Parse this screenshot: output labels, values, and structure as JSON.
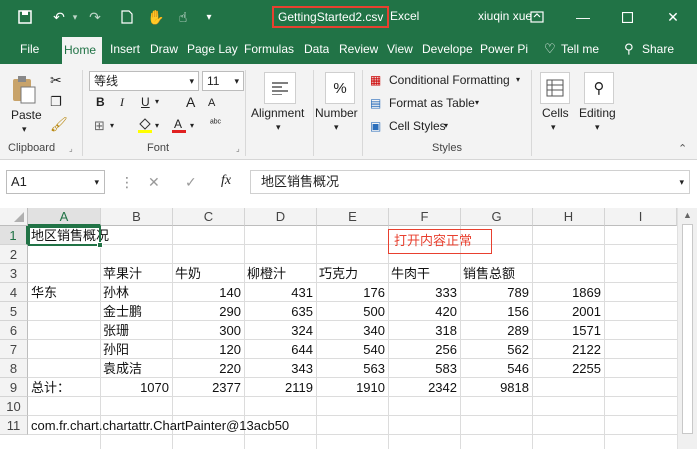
{
  "titlebar": {
    "file_name": "GettingStarted2.csv",
    "app_name": "Excel",
    "user": "xiuqin xue"
  },
  "tabs": [
    "File",
    "Home",
    "Insert",
    "Draw",
    "Page Layo",
    "Formulas",
    "Data",
    "Review",
    "View",
    "Develope",
    "Power Pi",
    "Tell me",
    "Share"
  ],
  "ribbon": {
    "clipboard": {
      "paste": "Paste",
      "label": "Clipboard"
    },
    "font": {
      "name": "等线",
      "size": "11",
      "bold": "B",
      "italic": "I",
      "underline": "U",
      "grow": "A",
      "shrink": "A",
      "label": "Font"
    },
    "alignment": {
      "label": "Alignment"
    },
    "number": {
      "label": "Number",
      "icon_text": "%"
    },
    "styles": {
      "conditional": "Conditional Formatting",
      "table": "Format as Table",
      "cell": "Cell Styles",
      "label": "Styles"
    },
    "cells": {
      "label": "Cells"
    },
    "editing": {
      "label": "Editing"
    }
  },
  "formula_bar": {
    "name_box": "A1",
    "fx": "fx",
    "content": "地区销售概况"
  },
  "columns": [
    "A",
    "B",
    "C",
    "D",
    "E",
    "F",
    "G",
    "H",
    "I"
  ],
  "rows": [
    "1",
    "2",
    "3",
    "4",
    "5",
    "6",
    "7",
    "8",
    "9",
    "10",
    "11"
  ],
  "cells": {
    "A1": "地区销售概况",
    "B3": "苹果汁",
    "C3": "牛奶",
    "D3": "柳橙汁",
    "E3": "巧克力",
    "F3": "牛肉干",
    "G3": "销售总额",
    "A4": "华东",
    "B4": "孙林",
    "C4": "140",
    "D4": "431",
    "E4": "176",
    "F4": "333",
    "G4": "789",
    "H4": "1869",
    "B5": "金士鹏",
    "C5": "290",
    "D5": "635",
    "E5": "500",
    "F5": "420",
    "G5": "156",
    "H5": "2001",
    "B6": "张珊",
    "C6": "300",
    "D6": "324",
    "E6": "340",
    "F6": "318",
    "G6": "289",
    "H6": "1571",
    "B7": "孙阳",
    "C7": "120",
    "D7": "644",
    "E7": "540",
    "F7": "256",
    "G7": "562",
    "H7": "2122",
    "B8": "袁成洁",
    "C8": "220",
    "D8": "343",
    "E8": "563",
    "F8": "583",
    "G8": "546",
    "H8": "2255",
    "A9": "总计：",
    "B9": "1070",
    "C9": "2377",
    "D9": "2119",
    "E9": "1910",
    "F9": "2342",
    "G9": "9818",
    "A11": "com.fr.chart.chartattr.ChartPainter@13acb50"
  },
  "annotation": "打开内容正常",
  "colors": {
    "accent": "#217346",
    "highlight_box": "#e8402f"
  }
}
